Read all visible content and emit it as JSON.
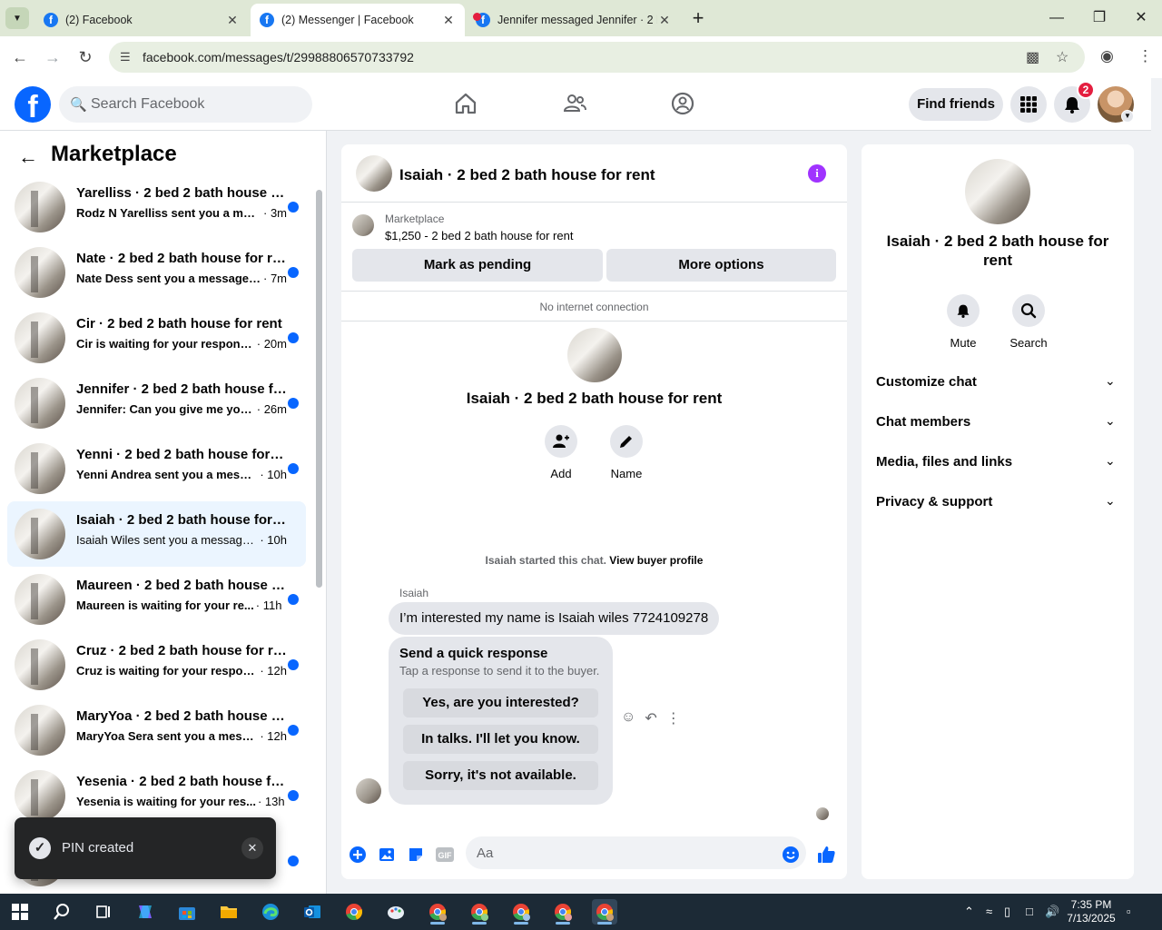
{
  "browser": {
    "tabs": [
      {
        "title": "(2) Facebook",
        "active": false
      },
      {
        "title": "(2) Messenger | Facebook",
        "active": true
      },
      {
        "title": "Jennifer messaged Jennifer · 2 b",
        "active": false
      }
    ],
    "url": "facebook.com/messages/t/29988806570733792"
  },
  "fb_header": {
    "logo": "f",
    "search_placeholder": "Search Facebook",
    "find_friends": "Find friends",
    "notification_count": "2"
  },
  "sidebar": {
    "title": "Marketplace",
    "conversations": [
      {
        "name": "Yarelliss · 2 bed 2 bath house for rent",
        "preview": "Rodz N Yarelliss sent you a mes...",
        "time": " · 3m"
      },
      {
        "name": "Nate · 2 bed 2 bath house for rent",
        "preview": "Nate Dess sent you a message ...",
        "time": " · 7m"
      },
      {
        "name": "Cir · 2 bed 2 bath house for rent",
        "preview": "Cir is waiting for your response.",
        "time": " · 20m"
      },
      {
        "name": "Jennifer · 2 bed 2 bath house for rent",
        "preview": "Jennifer: Can you give me you...",
        "time": " · 26m"
      },
      {
        "name": "Yenni · 2 bed 2 bath house for rent",
        "preview": "Yenni Andrea sent you a messa...",
        "time": " · 10h"
      },
      {
        "name": "Isaiah · 2 bed 2 bath house for rent",
        "preview": "Isaiah Wiles sent you a message a...",
        "time": " · 10h"
      },
      {
        "name": "Maureen · 2 bed 2 bath house for rent",
        "preview": "Maureen is waiting for your re...",
        "time": " · 11h"
      },
      {
        "name": "Cruz · 2 bed 2 bath house for rent",
        "preview": "Cruz is waiting for your respon...",
        "time": " · 12h"
      },
      {
        "name": "MaryYoa · 2 bed 2 bath house for rent",
        "preview": "MaryYoa Sera sent you a mess...",
        "time": " · 12h"
      },
      {
        "name": "Yesenia · 2 bed 2 bath house for rent",
        "preview": "Yesenia is waiting for your res...",
        "time": " · 13h"
      }
    ]
  },
  "toast": {
    "message": "PIN created"
  },
  "chat": {
    "title": "Isaiah · 2 bed 2 bath house for rent",
    "marketplace_label": "Marketplace",
    "listing": "$1,250 - 2 bed 2 bath house for rent",
    "mark_pending": "Mark as pending",
    "more_options": "More options",
    "connection_status": "No internet connection",
    "profile_title": "Isaiah · 2 bed 2 bath house for rent",
    "add_label": "Add",
    "name_label": "Name",
    "started_text": "Isaiah started this chat.",
    "buyer_profile_link": "View buyer profile",
    "sender": "Isaiah",
    "message": "I’m interested my name is Isaiah wiles 7724109278",
    "quick_title": "Send a quick response",
    "quick_subtitle": "Tap a response to send it to the buyer.",
    "quick_responses": [
      "Yes, are you interested?",
      "In talks. I'll let you know.",
      "Sorry, it's not available."
    ],
    "composer_placeholder": "Aa"
  },
  "info_panel": {
    "title": "Isaiah · 2 bed 2 bath house for rent",
    "mute": "Mute",
    "search": "Search",
    "sections": [
      "Customize chat",
      "Chat members",
      "Media, files and links",
      "Privacy & support"
    ]
  },
  "taskbar": {
    "time": "7:35 PM",
    "date": "7/13/2025"
  },
  "colors": {
    "fb_blue": "#0866ff",
    "unread_dot": "#0866ff",
    "badge_red": "#e41e3f",
    "info_purple": "#a033ff",
    "selected_row": "#ebf5ff"
  }
}
